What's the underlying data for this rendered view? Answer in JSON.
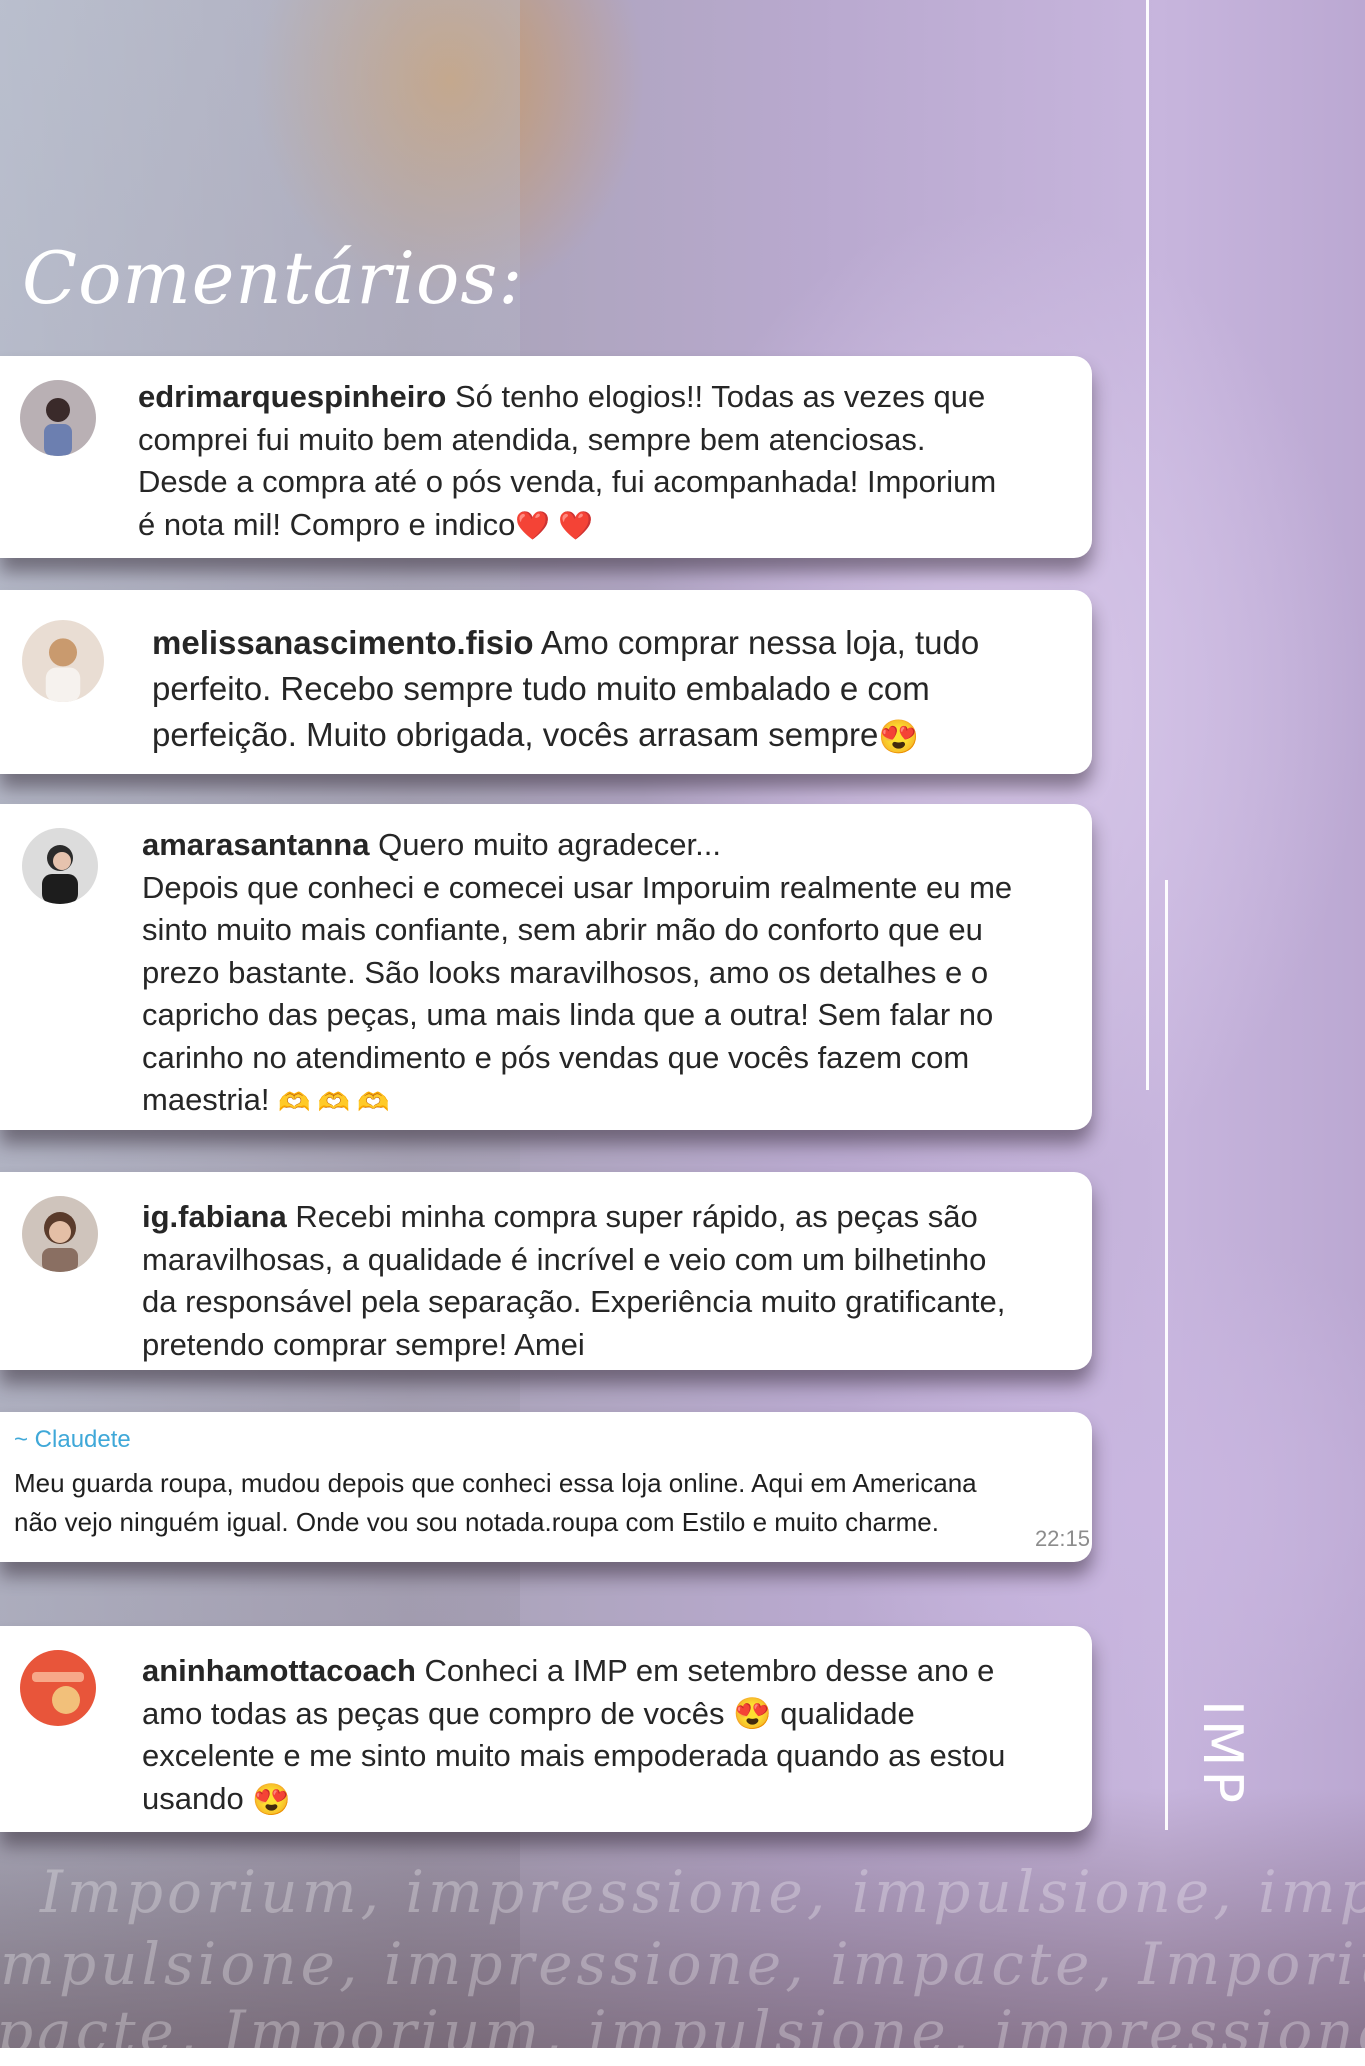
{
  "page": {
    "title": "Comentários:",
    "brand": "IMP"
  },
  "comments": [
    {
      "user": "edrimarquespinheiro",
      "text": "Só tenho elogios!! Todas as vezes que\ncomprei fui muito bem atendida, sempre bem atenciosas.\nDesde a compra até o pós venda, fui acompanhada! Imporium\né nota mil! Compro e indico",
      "emoji": "❤️ ❤️"
    },
    {
      "user": "melissanascimento.fisio",
      "text": "Amo comprar nessa loja, tudo\nperfeito. Recebo sempre tudo muito embalado e com\nperfeição. Muito obrigada, vocês arrasam sempre",
      "emoji": "😍"
    },
    {
      "user": "amarasantanna",
      "text": "Quero muito agradecer...\nDepois que conheci e comecei usar Imporuim realmente eu me\nsinto muito mais confiante, sem abrir mão do conforto que eu\nprezo bastante. São looks maravilhosos, amo os detalhes e o\ncapricho das peças, uma mais linda que a outra! Sem falar no\ncarinho no atendimento e pós vendas que vocês fazem com\nmaestria!",
      "emoji": "🫶 🫶 🫶"
    },
    {
      "user": "ig.fabiana",
      "text": "Recebi minha compra super rápido, as peças são\nmaravilhosas, a qualidade é incrível e veio com um bilhetinho\nda responsável pela separação. Experiência muito gratificante,\npretendo comprar sempre! Amei",
      "emoji": ""
    },
    {
      "user": "aninhamottacoach",
      "text": "Conheci a IMP em setembro desse ano e\namo todas as peças que compro de vocês 😍 qualidade\nexcelente e me sinto muito mais empoderada quando as estou\nusando",
      "emoji": "😍"
    }
  ],
  "whatsapp": {
    "name": "~ Claudete",
    "text": "Meu guarda roupa, mudou depois que conheci essa loja online. Aqui em Americana\nnão vejo ninguém igual. Onde vou sou notada.roupa com Estilo e muito charme.",
    "time": "22:15"
  },
  "slogan_lines": [
    "Imporium, impressione, impulsione, impacte",
    "mpulsione, impressione, impacte, Imporium",
    "pacte, Imporium, impulsione, impressione, I"
  ],
  "colors": {
    "accent": "#3fa8d8",
    "text": "#262626",
    "card": "#ffffff"
  }
}
